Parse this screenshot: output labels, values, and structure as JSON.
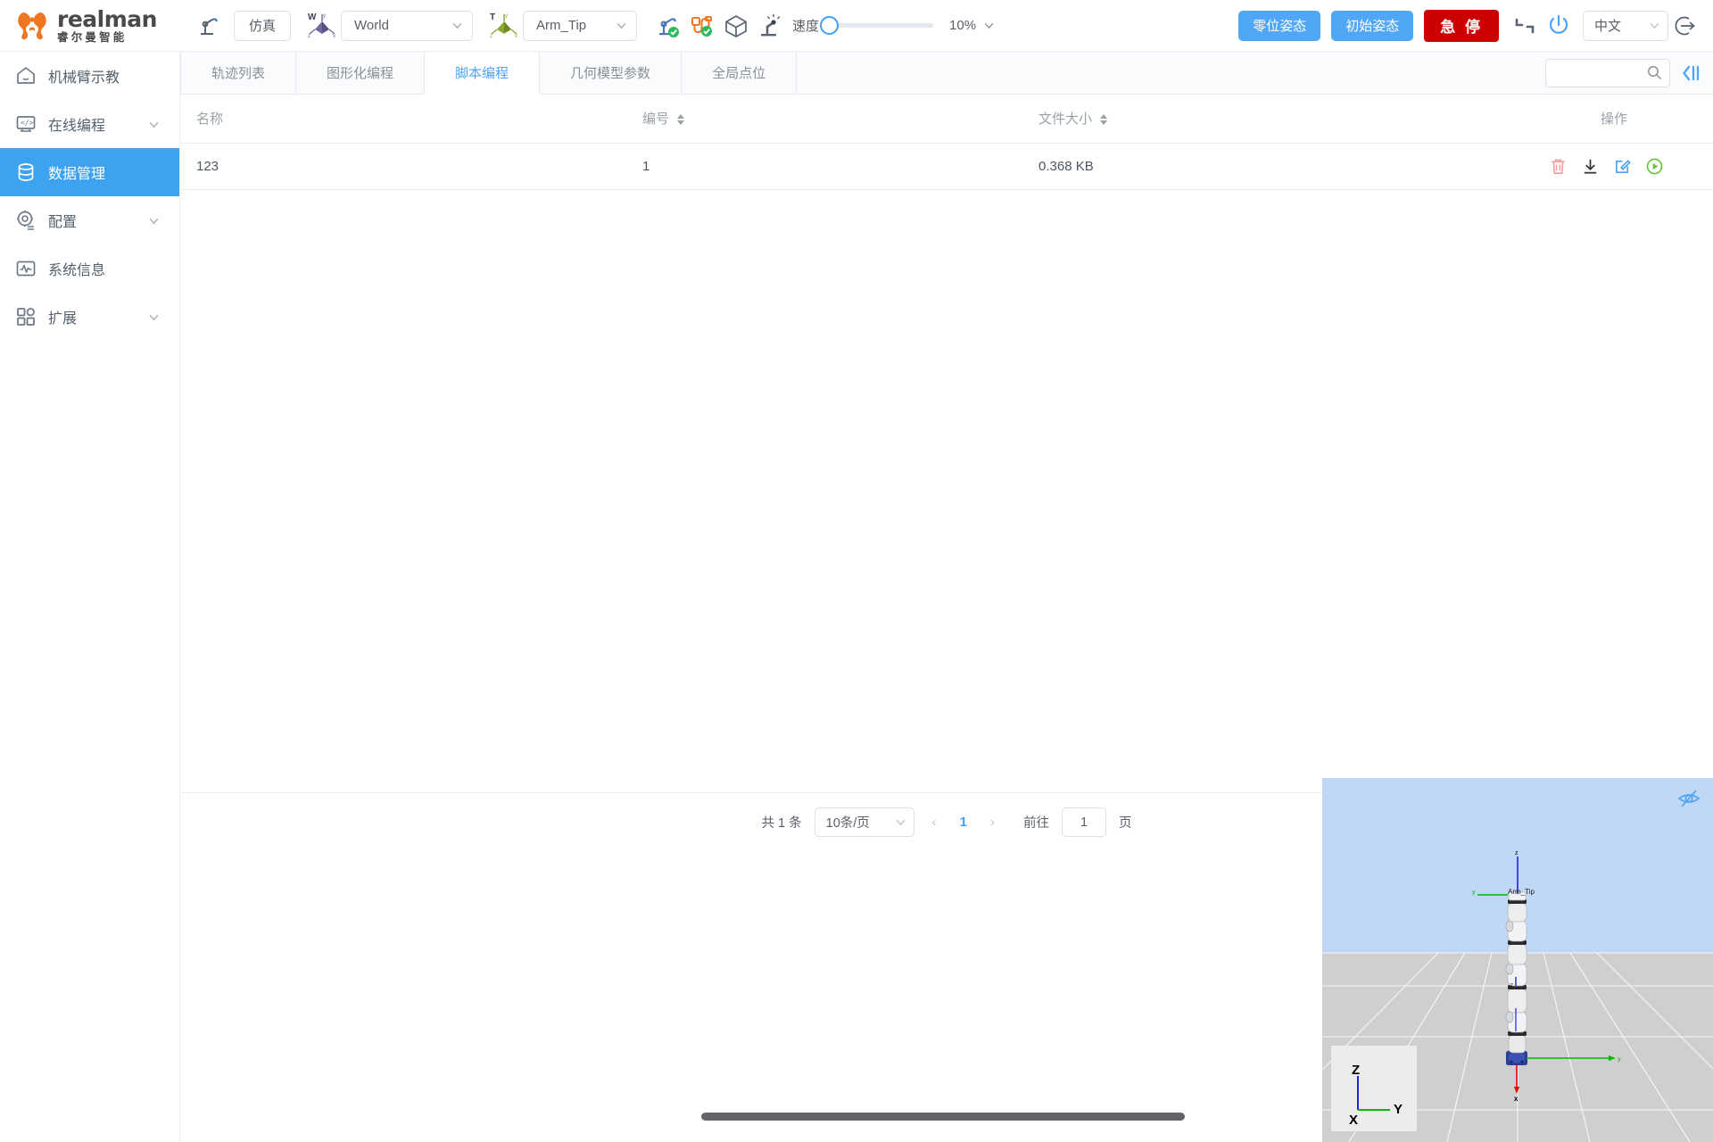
{
  "brand": {
    "en": "realman",
    "cn": "睿尔曼智能"
  },
  "toolbar": {
    "teach_icon": "robot-arm-teach-icon",
    "sim_label": "仿真",
    "world_frame": {
      "tag": "W",
      "value": "World",
      "icon": "coordinate-frame-icon"
    },
    "tool_frame": {
      "tag": "T",
      "value": "Arm_Tip",
      "icon": "coordinate-frame-icon"
    },
    "status_icons": [
      {
        "name": "robot-connected-icon",
        "badge": "check"
      },
      {
        "name": "cable-connected-icon",
        "badge": "check"
      },
      {
        "name": "cube-model-icon",
        "badge": "none"
      },
      {
        "name": "collision-detect-icon",
        "badge": "none"
      }
    ],
    "speed_label": "速度",
    "speed_percent": "10%",
    "speed_value": 10,
    "zero_pose_label": "零位姿态",
    "init_pose_label": "初始姿态",
    "estop_label": "急 停",
    "disconnect_icon": "disconnect-icon",
    "power_icon": "power-icon",
    "language": "中文",
    "logout_icon": "logout-icon"
  },
  "sidebar": {
    "items": [
      {
        "label": "机械臂示教",
        "icon": "home-icon",
        "active": false,
        "expandable": false
      },
      {
        "label": "在线编程",
        "icon": "code-icon",
        "active": false,
        "expandable": true
      },
      {
        "label": "数据管理",
        "icon": "database-icon",
        "active": true,
        "expandable": false
      },
      {
        "label": "配置",
        "icon": "gear-icon",
        "active": false,
        "expandable": true
      },
      {
        "label": "系统信息",
        "icon": "activity-icon",
        "active": false,
        "expandable": false
      },
      {
        "label": "扩展",
        "icon": "grid-icon",
        "active": false,
        "expandable": true
      }
    ]
  },
  "tabs": [
    {
      "label": "轨迹列表",
      "active": false
    },
    {
      "label": "图形化编程",
      "active": false
    },
    {
      "label": "脚本编程",
      "active": true
    },
    {
      "label": "几何模型参数",
      "active": false
    },
    {
      "label": "全局点位",
      "active": false
    }
  ],
  "search": {
    "value": "",
    "placeholder": "",
    "icon": "search-icon"
  },
  "collapse_icon": "collapse-panel-icon",
  "table": {
    "columns": [
      {
        "label": "名称",
        "sortable": false,
        "align": "left"
      },
      {
        "label": "编号",
        "sortable": true,
        "align": "left"
      },
      {
        "label": "文件大小",
        "sortable": true,
        "align": "left"
      },
      {
        "label": "操作",
        "sortable": false,
        "align": "right"
      }
    ],
    "rows": [
      {
        "name": "123",
        "number": "1",
        "size": "0.368 KB"
      }
    ],
    "row_actions": [
      {
        "name": "delete-icon",
        "color": "#f59d9d"
      },
      {
        "name": "download-icon",
        "color": "#303133"
      },
      {
        "name": "edit-icon",
        "color": "#4da3f5"
      },
      {
        "name": "run-icon",
        "color": "#67c23a"
      }
    ]
  },
  "pagination": {
    "total_label": "共 1 条",
    "page_size": "10条/页",
    "prev_icon": "chevron-left-icon",
    "current_page": "1",
    "next_icon": "chevron-right-icon",
    "goto_label": "前往",
    "goto_value": "1",
    "page_unit": "页"
  },
  "viewport": {
    "eye_icon": "hide-eye-icon",
    "tip_label": "Arm_Tip",
    "axes": {
      "z": "Z",
      "y": "Y",
      "x": "X"
    },
    "world_axes": {
      "z": "z",
      "y": "y",
      "x": "x"
    },
    "colors": {
      "sky": "#bed8f5",
      "ground": "#cfcfd1",
      "x_axis": "#ee0000",
      "y_axis": "#00bb00",
      "z_axis": "#2222dd"
    }
  },
  "colors": {
    "accent": "#3da2f0",
    "danger": "#cc0000",
    "success": "#67c23a",
    "brand_orange": "#ef7622"
  }
}
